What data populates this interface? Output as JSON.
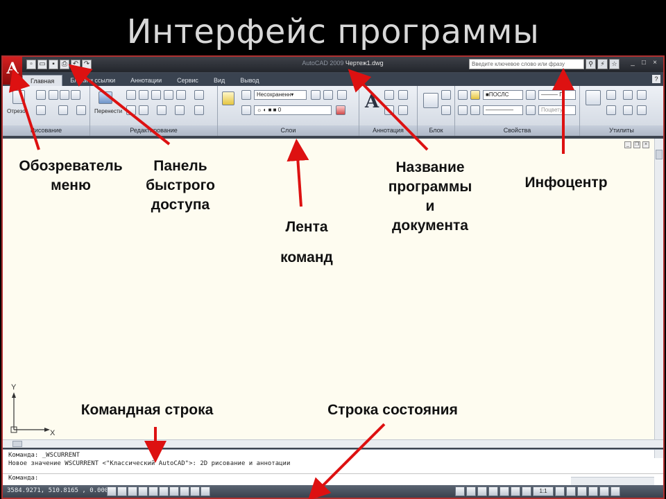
{
  "slide_title": "Интерфейс программы",
  "app": {
    "logo_letter": "A",
    "title_app": "AutoCAD 2009",
    "title_doc": "Чертеж1.dwg",
    "search_placeholder": "Введите ключевое слово или фразу",
    "tabs": [
      "Главная",
      "Блоки и ссылки",
      "Аннотации",
      "Сервис",
      "Вид",
      "Вывод"
    ],
    "help_label": "?",
    "window_buttons": [
      "_",
      "□",
      "×"
    ]
  },
  "ribbon": {
    "panels": [
      "Рисование",
      "Редактирование",
      "Слои",
      "Аннотация",
      "Блок",
      "Свойства",
      "Утилиты"
    ],
    "draw_label": "Отрезок",
    "move_label": "Перенести",
    "layer_state": "Несохраненн▾",
    "layer_current": "0",
    "color_bylayer": "ПОСЛС",
    "lineweight_bylayer": "П",
    "plot_style": "Поцвету"
  },
  "annotations": {
    "menu_browser": [
      "Обозреватель",
      "меню"
    ],
    "quick_access": [
      "Панель",
      "быстрого",
      "доступа"
    ],
    "ribbon": [
      "Лента",
      "команд"
    ],
    "program_title": [
      "Название",
      "программы",
      "и",
      "документа"
    ],
    "infocenter": "Инфоцентр",
    "command_line": "Командная строка",
    "status_bar": "Строка состояния"
  },
  "ucs": {
    "y": "Y",
    "x": "X"
  },
  "command": {
    "line1": "Команда: _WSCURRENT",
    "line2": "Новое значение WSCURRENT <\"Классический AutoCAD\">: 2D рисование и аннотации",
    "prompt": "Команда:"
  },
  "status": {
    "coords": "3584.9271, 510.8165 , 0.0000",
    "scale": "1:1"
  },
  "colors": {
    "arrow": "#dd1111",
    "frame": "#b03030"
  }
}
